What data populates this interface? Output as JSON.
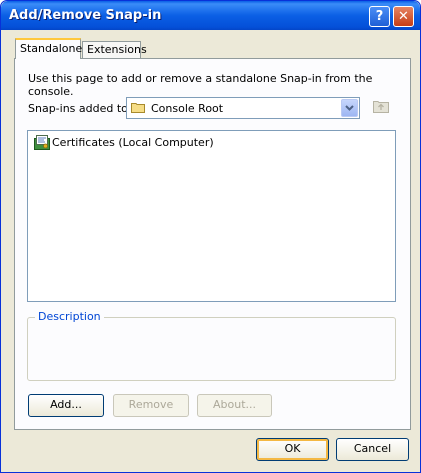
{
  "window": {
    "title": "Add/Remove Snap-in",
    "help_label": "?",
    "close_label": "✕"
  },
  "tabs": [
    {
      "label": "Standalone",
      "active": true
    },
    {
      "label": "Extensions",
      "active": false
    }
  ],
  "standalone": {
    "intro_text": "Use this page to add or remove a standalone Snap-in from the console.",
    "snapins_label": "Snap-ins added to:",
    "snapins_value": "Console Root",
    "items": [
      {
        "label": "Certificates (Local Computer)",
        "icon": "certificate-snapin-icon"
      }
    ],
    "description_legend": "Description",
    "description_text": ""
  },
  "buttons": {
    "add": "Add...",
    "remove": "Remove",
    "about": "About...",
    "ok": "OK",
    "cancel": "Cancel"
  },
  "colors": {
    "title_bar": "#0a5fe6",
    "dialog_bg": "#ece9d8",
    "accent_tab": "#ffc83c",
    "legend": "#0046d5"
  }
}
